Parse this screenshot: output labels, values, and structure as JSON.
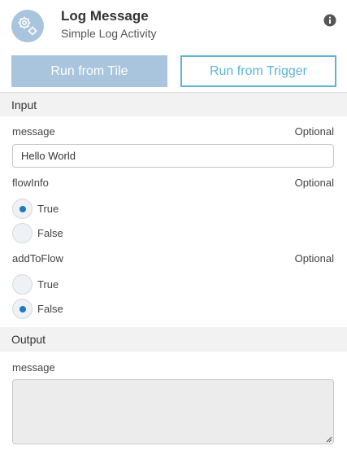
{
  "header": {
    "title": "Log Message",
    "subtitle": "Simple Log Activity",
    "icon": "gears-icon",
    "info_icon": "info-icon"
  },
  "actions": {
    "run_from_tile": "Run from Tile",
    "run_from_trigger": "Run from Trigger"
  },
  "input_section": {
    "heading": "Input",
    "message": {
      "label": "message",
      "optional": "Optional",
      "value": "Hello World"
    },
    "flowInfo": {
      "label": "flowInfo",
      "optional": "Optional",
      "options": [
        {
          "label": "True",
          "selected": true
        },
        {
          "label": "False",
          "selected": false
        }
      ]
    },
    "addToFlow": {
      "label": "addToFlow",
      "optional": "Optional",
      "options": [
        {
          "label": "True",
          "selected": false
        },
        {
          "label": "False",
          "selected": true
        }
      ]
    }
  },
  "output_section": {
    "heading": "Output",
    "message": {
      "label": "message",
      "value": ""
    }
  },
  "colors": {
    "accent": "#5bb4d6",
    "button_fill": "#a9c4dd",
    "radio_dot": "#1f78c1",
    "section_bg": "#f2f2f2"
  }
}
